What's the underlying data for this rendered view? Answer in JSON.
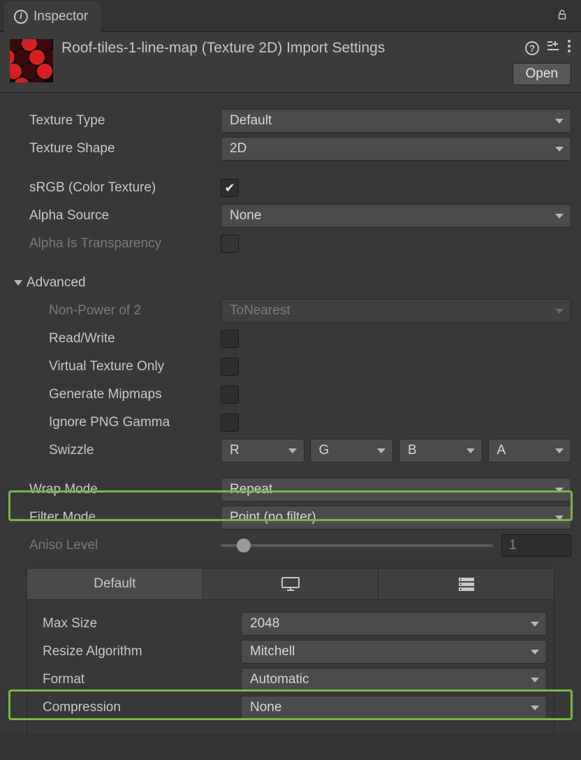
{
  "tab": {
    "title": "Inspector"
  },
  "header": {
    "title": "Roof-tiles-1-line-map (Texture 2D) Import Settings",
    "open_label": "Open"
  },
  "fields": {
    "texture_type": {
      "label": "Texture Type",
      "value": "Default"
    },
    "texture_shape": {
      "label": "Texture Shape",
      "value": "2D"
    },
    "srgb": {
      "label": "sRGB (Color Texture)",
      "checked": true
    },
    "alpha_source": {
      "label": "Alpha Source",
      "value": "None"
    },
    "alpha_is_transparency": {
      "label": "Alpha Is Transparency",
      "checked": false
    },
    "advanced": {
      "label": "Advanced"
    },
    "npot": {
      "label": "Non-Power of 2",
      "value": "ToNearest"
    },
    "read_write": {
      "label": "Read/Write",
      "checked": false
    },
    "virtual_texture": {
      "label": "Virtual Texture Only",
      "checked": false
    },
    "gen_mipmaps": {
      "label": "Generate Mipmaps",
      "checked": false
    },
    "ignore_png_gamma": {
      "label": "Ignore PNG Gamma",
      "checked": false
    },
    "swizzle": {
      "label": "Swizzle",
      "r": "R",
      "g": "G",
      "b": "B",
      "a": "A"
    },
    "wrap_mode": {
      "label": "Wrap Mode",
      "value": "Repeat"
    },
    "filter_mode": {
      "label": "Filter Mode",
      "value": "Point (no filter)"
    },
    "aniso": {
      "label": "Aniso Level",
      "value": "1"
    }
  },
  "platform": {
    "tabs": {
      "default": "Default"
    },
    "max_size": {
      "label": "Max Size",
      "value": "2048"
    },
    "resize_algo": {
      "label": "Resize Algorithm",
      "value": "Mitchell"
    },
    "format": {
      "label": "Format",
      "value": "Automatic"
    },
    "compression": {
      "label": "Compression",
      "value": "None"
    }
  }
}
